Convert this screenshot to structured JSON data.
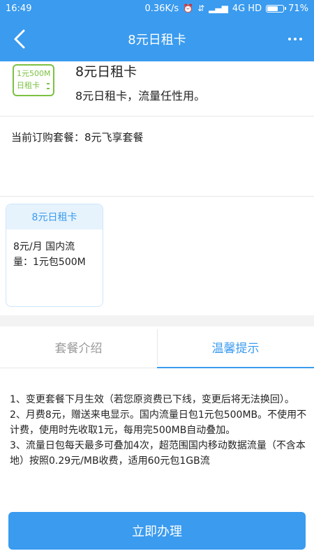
{
  "status_bar": {
    "time": "16:49",
    "network_speed": "0.36K/s",
    "network": "4G HD",
    "battery_percent": "71%",
    "battery_level": 0.71
  },
  "nav": {
    "title": "8元日租卡",
    "back_icon": "chevron-left-icon",
    "more_icon": "more-icon"
  },
  "product": {
    "logo_line1": "1元500M",
    "logo_line2": "日租卡",
    "name": "8元日租卡",
    "description": "8元日租卡，流量任性用。"
  },
  "current_plan": "当前订购套餐：8元飞享套餐",
  "package_card": {
    "title": "8元日租卡",
    "line1": "8元/月 国内流",
    "line2": "量：1元包500M"
  },
  "tabs": [
    {
      "label": "套餐介绍",
      "active": false
    },
    {
      "label": "温馨提示",
      "active": true
    }
  ],
  "tips": [
    "1、变更套餐下月生效（若您原资费已下线，变更后将无法换回）。",
    "2、月费8元，赠送来电显示。国内流量日包1元包500MB。不使用不计费，使用时先收取1元，每用完500MB自动叠加。",
    "3、流量日包每天最多可叠加4次，超范围国内移动数据流量（不含本地）按照0.29元/MB收费，适用60元包1GB流"
  ],
  "cta_label": "立即办理",
  "colors": {
    "primary": "#3a9bef",
    "logo_green": "#7cc142"
  }
}
